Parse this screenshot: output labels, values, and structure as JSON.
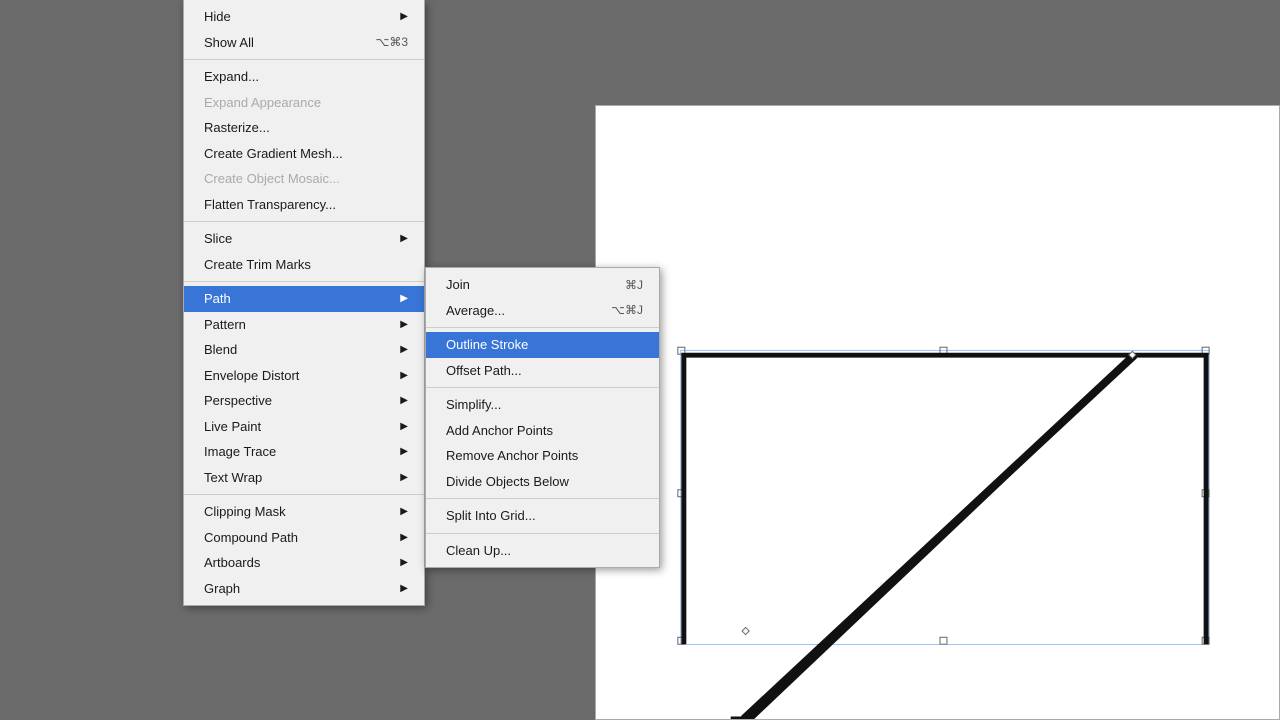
{
  "background_color": "#6b6b6b",
  "main_menu": {
    "items": [
      {
        "id": "hide",
        "label": "Hide",
        "shortcut": "",
        "has_arrow": true,
        "disabled": false,
        "separator_after": false
      },
      {
        "id": "show-all",
        "label": "Show All",
        "shortcut": "⌥⌘3",
        "has_arrow": false,
        "disabled": false,
        "separator_after": true
      },
      {
        "id": "expand",
        "label": "Expand...",
        "shortcut": "",
        "has_arrow": false,
        "disabled": false,
        "separator_after": false
      },
      {
        "id": "expand-appearance",
        "label": "Expand Appearance",
        "shortcut": "",
        "has_arrow": false,
        "disabled": true,
        "separator_after": false
      },
      {
        "id": "rasterize",
        "label": "Rasterize...",
        "shortcut": "",
        "has_arrow": false,
        "disabled": false,
        "separator_after": false
      },
      {
        "id": "create-gradient-mesh",
        "label": "Create Gradient Mesh...",
        "shortcut": "",
        "has_arrow": false,
        "disabled": false,
        "separator_after": false
      },
      {
        "id": "create-object-mosaic",
        "label": "Create Object Mosaic...",
        "shortcut": "",
        "has_arrow": false,
        "disabled": true,
        "separator_after": false
      },
      {
        "id": "flatten-transparency",
        "label": "Flatten Transparency...",
        "shortcut": "",
        "has_arrow": false,
        "disabled": false,
        "separator_after": true
      },
      {
        "id": "slice",
        "label": "Slice",
        "shortcut": "",
        "has_arrow": true,
        "disabled": false,
        "separator_after": false
      },
      {
        "id": "create-trim-marks",
        "label": "Create Trim Marks",
        "shortcut": "",
        "has_arrow": false,
        "disabled": false,
        "separator_after": true
      },
      {
        "id": "path",
        "label": "Path",
        "shortcut": "",
        "has_arrow": true,
        "disabled": false,
        "highlighted": true,
        "separator_after": false
      },
      {
        "id": "pattern",
        "label": "Pattern",
        "shortcut": "",
        "has_arrow": true,
        "disabled": false,
        "separator_after": false
      },
      {
        "id": "blend",
        "label": "Blend",
        "shortcut": "",
        "has_arrow": true,
        "disabled": false,
        "separator_after": false
      },
      {
        "id": "envelope-distort",
        "label": "Envelope Distort",
        "shortcut": "",
        "has_arrow": true,
        "disabled": false,
        "separator_after": false
      },
      {
        "id": "perspective",
        "label": "Perspective",
        "shortcut": "",
        "has_arrow": true,
        "disabled": false,
        "separator_after": false
      },
      {
        "id": "live-paint",
        "label": "Live Paint",
        "shortcut": "",
        "has_arrow": true,
        "disabled": false,
        "separator_after": false
      },
      {
        "id": "image-trace",
        "label": "Image Trace",
        "shortcut": "",
        "has_arrow": true,
        "disabled": false,
        "separator_after": false
      },
      {
        "id": "text-wrap",
        "label": "Text Wrap",
        "shortcut": "",
        "has_arrow": true,
        "disabled": false,
        "separator_after": true
      },
      {
        "id": "clipping-mask",
        "label": "Clipping Mask",
        "shortcut": "",
        "has_arrow": true,
        "disabled": false,
        "separator_after": false
      },
      {
        "id": "compound-path",
        "label": "Compound Path",
        "shortcut": "",
        "has_arrow": true,
        "disabled": false,
        "separator_after": false
      },
      {
        "id": "artboards",
        "label": "Artboards",
        "shortcut": "",
        "has_arrow": true,
        "disabled": false,
        "separator_after": false
      },
      {
        "id": "graph",
        "label": "Graph",
        "shortcut": "",
        "has_arrow": true,
        "disabled": false,
        "separator_after": false
      }
    ]
  },
  "path_submenu": {
    "items": [
      {
        "id": "join",
        "label": "Join",
        "shortcut": "⌘J",
        "highlighted": false,
        "separator_after": false
      },
      {
        "id": "average",
        "label": "Average...",
        "shortcut": "⌥⌘J",
        "highlighted": false,
        "separator_after": true
      },
      {
        "id": "outline-stroke",
        "label": "Outline Stroke",
        "shortcut": "",
        "highlighted": true,
        "separator_after": false
      },
      {
        "id": "offset-path",
        "label": "Offset Path...",
        "shortcut": "",
        "highlighted": false,
        "separator_after": true
      },
      {
        "id": "simplify",
        "label": "Simplify...",
        "shortcut": "",
        "highlighted": false,
        "separator_after": false
      },
      {
        "id": "add-anchor-points",
        "label": "Add Anchor Points",
        "shortcut": "",
        "highlighted": false,
        "separator_after": false
      },
      {
        "id": "remove-anchor-points",
        "label": "Remove Anchor Points",
        "shortcut": "",
        "highlighted": false,
        "separator_after": false
      },
      {
        "id": "divide-objects-below",
        "label": "Divide Objects Below",
        "shortcut": "",
        "highlighted": false,
        "separator_after": true
      },
      {
        "id": "split-into-grid",
        "label": "Split Into Grid...",
        "shortcut": "",
        "highlighted": false,
        "separator_after": true
      },
      {
        "id": "clean-up",
        "label": "Clean Up...",
        "shortcut": "",
        "highlighted": false,
        "separator_after": false
      }
    ]
  },
  "canvas": {
    "background": "white"
  }
}
